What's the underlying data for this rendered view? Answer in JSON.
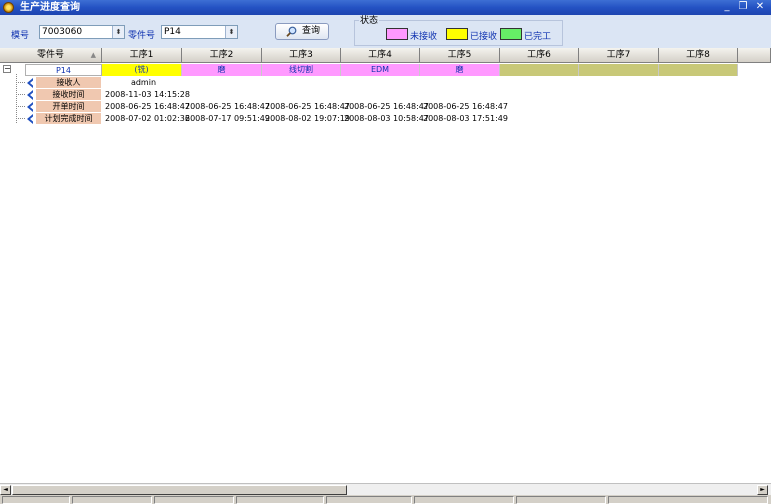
{
  "window": {
    "title": "生产进度查询",
    "min": "_",
    "restore": "❐",
    "close": "✕"
  },
  "toolbar": {
    "mold_label": "模号",
    "mold_value": "7003060",
    "part_label": "零件号",
    "part_value": "P14",
    "query_label": "查询",
    "status_group_label": "状态",
    "legend": [
      {
        "label": "未接收",
        "color": "#ff99ff"
      },
      {
        "label": "已接收",
        "color": "#ffff00"
      },
      {
        "label": "已完工",
        "color": "#66ee66"
      }
    ]
  },
  "grid": {
    "columns": [
      "零件号",
      "工序1",
      "工序2",
      "工序3",
      "工序4",
      "工序5",
      "工序6",
      "工序7",
      "工序8"
    ],
    "sort_indicator": "▲",
    "part_row": {
      "part": "P14",
      "processes": [
        {
          "name": "(铣)",
          "color": "#ffff00"
        },
        {
          "name": "磨",
          "color": "#ff99ff"
        },
        {
          "name": "线切割",
          "color": "#ff99ff"
        },
        {
          "name": "EDM",
          "color": "#ff99ff"
        },
        {
          "name": "磨",
          "color": "#ff99ff"
        },
        {
          "name": "",
          "color": "#c8c878"
        },
        {
          "name": "",
          "color": "#c8c878"
        },
        {
          "name": "",
          "color": "#c8c878"
        }
      ]
    },
    "detail_rows": [
      {
        "label": "接收人",
        "values": [
          "admin",
          "",
          "",
          "",
          ""
        ]
      },
      {
        "label": "接收时间",
        "values": [
          "2008-11-03 14:15:28",
          "",
          "",
          "",
          ""
        ]
      },
      {
        "label": "开单时间",
        "values": [
          "2008-06-25 16:48:47",
          "2008-06-25 16:48:47",
          "2008-06-25 16:48:47",
          "2008-06-25 16:48:47",
          "2008-06-25 16:48:47"
        ]
      },
      {
        "label": "计划完成时间",
        "values": [
          "2008-07-02 01:02:36",
          "2008-07-17 09:51:49",
          "2008-08-02 19:07:19",
          "2008-08-03 10:58:47",
          "2008-08-03 17:51:49"
        ]
      }
    ],
    "detail_label_color": "#f0c8b0",
    "collapse_glyph": "−"
  },
  "scroll": {
    "left_arrow": "◄",
    "right_arrow": "►"
  }
}
